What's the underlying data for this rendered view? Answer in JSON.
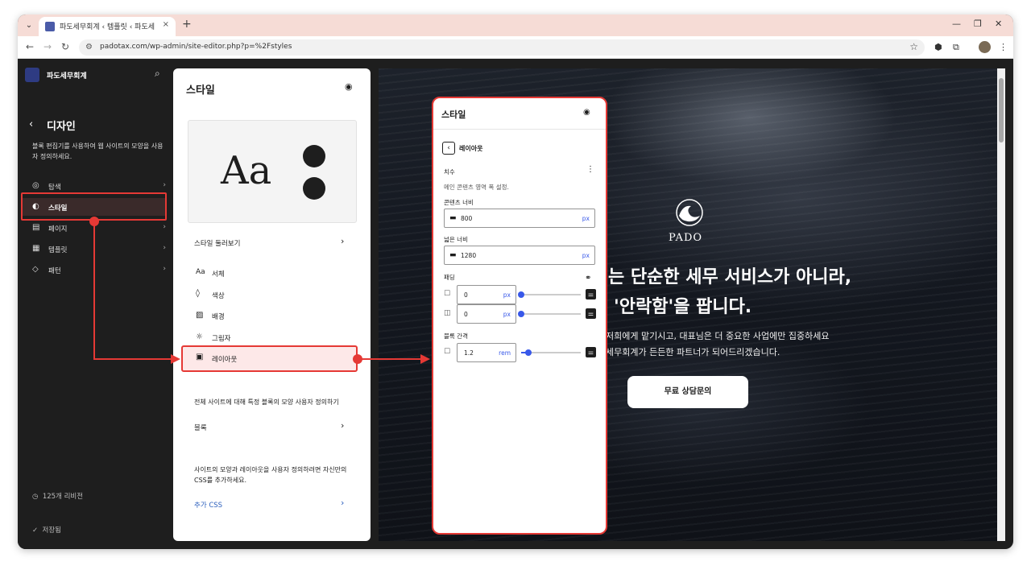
{
  "browser": {
    "tab_title": "파도세무회계 ‹ 템플릿 ‹ 파도세",
    "tab_close": "×",
    "new_tab": "+",
    "url": "padotax.com/wp-admin/site-editor.php?p=%2Fstyles",
    "controls": {
      "minimize": "—",
      "restore": "❐",
      "close": "✕"
    }
  },
  "sidebar": {
    "site_name": "파도세무회계",
    "section_title": "디자인",
    "description": "블록 편집기를 사용하여 웹 사이트의 모양을 사용자 정의하세요.",
    "items": [
      {
        "label": "탐색",
        "icon": "compass-icon"
      },
      {
        "label": "스타일",
        "icon": "half-circle-icon"
      },
      {
        "label": "페이지",
        "icon": "page-icon"
      },
      {
        "label": "템플릿",
        "icon": "layout-icon"
      },
      {
        "label": "패턴",
        "icon": "symbol-icon"
      }
    ],
    "revisions": "125개 리비전",
    "saved": "저장됨"
  },
  "styles_panel": {
    "title": "스타일",
    "preview_text": "Aa",
    "browse_styles": "스타일 둘러보기",
    "items": [
      {
        "label": "서체",
        "icon": "Aa"
      },
      {
        "label": "색상",
        "icon": "◊"
      },
      {
        "label": "배경",
        "icon": "▨"
      },
      {
        "label": "그림자",
        "icon": "☼"
      },
      {
        "label": "레이아웃",
        "icon": "▣"
      }
    ],
    "blocks_desc": "전체 사이트에 대해 특정 블록의 모양 사용자 정의하기",
    "blocks_label": "블록",
    "css_desc": "사이트의 모양과 레이아웃을 사용자 정의하려면 자신만의 CSS를 추가하세요.",
    "css_link": "추가 CSS"
  },
  "layout_panel": {
    "title": "스타일",
    "subtitle": "레이아웃",
    "dimensions_label": "치수",
    "dimensions_desc": "메인 콘텐츠 영역 폭 설정.",
    "content_width_label": "콘텐츠 너비",
    "content_width_value": "800",
    "content_width_unit": "px",
    "wide_width_label": "넓은 너비",
    "wide_width_value": "1280",
    "wide_width_unit": "px",
    "padding_label": "패딩",
    "padding_vertical_value": "0",
    "padding_horizontal_value": "0",
    "padding_unit": "px",
    "block_spacing_label": "블록 간격",
    "block_spacing_value": "1.2",
    "block_spacing_unit": "rem",
    "sliders": {
      "padding_vertical": 0,
      "padding_horizontal": 0,
      "block_spacing": 0.12
    }
  },
  "site": {
    "logo_text": "PADO",
    "hero_line1": "는 단순한 세무 서비스가 아니라,",
    "hero_line2": "'안락함'을 팝니다.",
    "sub_line1": "저희에게 맡기시고, 대표님은 더 중요한 사업에만 집중하세요",
    "sub_line2": "세무회계가 든든한 파트너가 되어드리겠습니다.",
    "cta": "무료 상담문의"
  },
  "colors": {
    "highlight": "#e53935",
    "accent": "#3858e9",
    "sidebar_bg": "#1e1e1e"
  }
}
